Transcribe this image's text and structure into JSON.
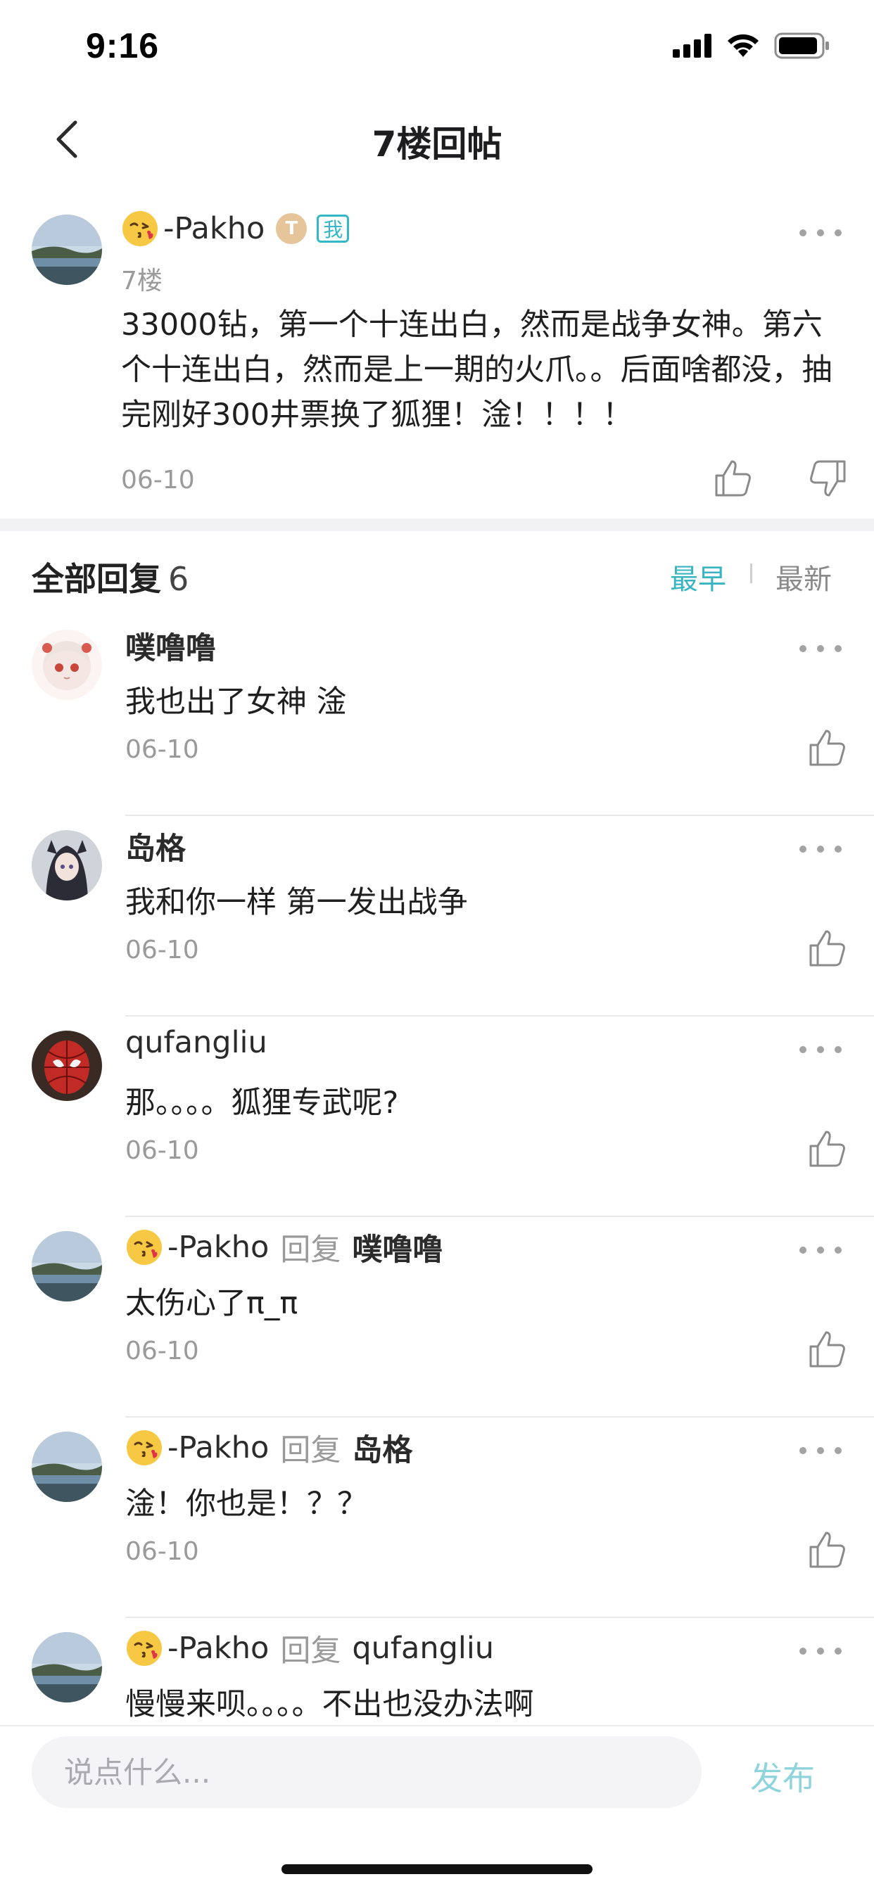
{
  "status_bar": {
    "time": "9:16"
  },
  "nav": {
    "title": "7楼回帖"
  },
  "post": {
    "author": "-Pakho",
    "badge_t": "T",
    "badge_me": "我",
    "floor": "7楼",
    "content": "33000钻，第一个十连出白，然而是战争女神。第六个十连出白，然而是上一期的火爪。。后面啥都没，抽完刚好300井票换了狐狸！淦！！！！",
    "date": "06-10"
  },
  "replies_header": {
    "title": "全部回复",
    "count": "6",
    "sort_earliest": "最早",
    "sort_newest": "最新",
    "active_sort": "最早"
  },
  "replies": [
    {
      "author": "噗噜噜",
      "reply_word": "",
      "target": "",
      "text": "我也出了女神  淦",
      "date": "06-10"
    },
    {
      "author": "岛格",
      "reply_word": "",
      "target": "",
      "text": "我和你一样 第一发出战争",
      "date": "06-10"
    },
    {
      "author": "qufangliu",
      "reply_word": "",
      "target": "",
      "text": "那。。。。狐狸专武呢?",
      "date": "06-10"
    },
    {
      "author": "-Pakho",
      "reply_word": "回复",
      "target": "噗噜噜",
      "text": "太伤心了π_π",
      "date": "06-10"
    },
    {
      "author": "-Pakho",
      "reply_word": "回复",
      "target": "岛格",
      "text": "淦！你也是！？？",
      "date": "06-10"
    },
    {
      "author": "-Pakho",
      "reply_word": "回复",
      "target": "qufangliu",
      "text": "慢慢来呗。。。。不出也没办法啊",
      "date": ""
    }
  ],
  "composer": {
    "placeholder": "说点什么...",
    "publish_label": "发布"
  },
  "colors": {
    "accent": "#39b4c2",
    "publish_disabled": "#8fd4dc",
    "muted_text": "#9a9a9a"
  },
  "icons": {
    "back": "chevron-left-icon",
    "more": "more-dots-icon",
    "like": "thumbs-up-icon",
    "dislike": "thumbs-down-icon",
    "emoji": "kiss-emoji-icon"
  }
}
